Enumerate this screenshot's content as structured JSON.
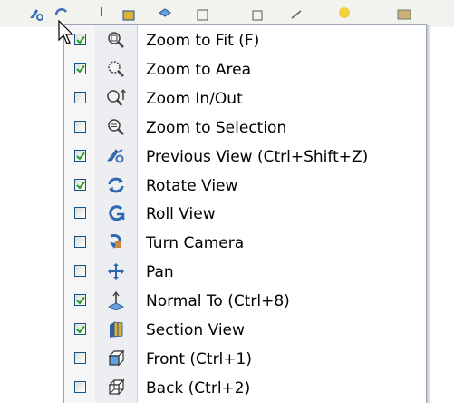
{
  "colors": {
    "menu_border": "#9aa6b8",
    "icon_gutter": "#eceef2",
    "check_mark": "#21a121",
    "icon_blue": "#1f5fa8"
  },
  "menu": {
    "items": [
      {
        "label": "Zoom to Fit   (F)",
        "checked": true,
        "icon": "zoom-to-fit-icon"
      },
      {
        "label": "Zoom to Area",
        "checked": true,
        "icon": "zoom-to-area-icon"
      },
      {
        "label": "Zoom In/Out",
        "checked": false,
        "icon": "zoom-in-out-icon"
      },
      {
        "label": "Zoom to Selection",
        "checked": false,
        "icon": "zoom-to-selection-icon"
      },
      {
        "label": "Previous View   (Ctrl+Shift+Z)",
        "checked": true,
        "icon": "previous-view-icon"
      },
      {
        "label": "Rotate View",
        "checked": true,
        "icon": "rotate-view-icon"
      },
      {
        "label": "Roll View",
        "checked": false,
        "icon": "roll-view-icon"
      },
      {
        "label": "Turn Camera",
        "checked": false,
        "icon": "turn-camera-icon"
      },
      {
        "label": "Pan",
        "checked": false,
        "icon": "pan-icon"
      },
      {
        "label": "Normal To   (Ctrl+8)",
        "checked": true,
        "icon": "normal-to-icon"
      },
      {
        "label": "Section View",
        "checked": true,
        "icon": "section-view-icon"
      },
      {
        "label": "Front   (Ctrl+1)",
        "checked": false,
        "icon": "front-view-icon"
      },
      {
        "label": "Back   (Ctrl+2)",
        "checked": false,
        "icon": "back-view-icon"
      }
    ]
  }
}
